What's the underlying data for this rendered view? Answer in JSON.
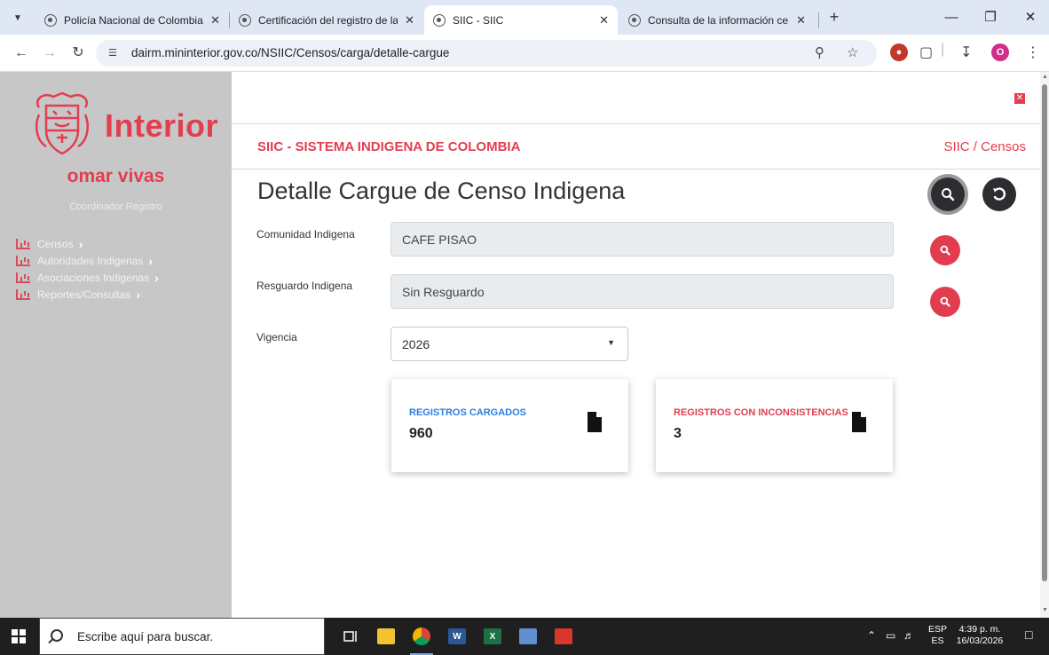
{
  "browser": {
    "tabs": [
      {
        "title": "Policía Nacional de Colombia",
        "active": false
      },
      {
        "title": "Certificación del registro de la a",
        "active": false
      },
      {
        "title": "SIIC - SIIC",
        "active": true
      },
      {
        "title": "Consulta de la información cens",
        "active": false
      }
    ],
    "url": "dairm.mininterior.gov.co/NSIIC/Censos/carga/detalle-cargue",
    "profile_initial": "O"
  },
  "sidebar": {
    "logo_text": "Interior",
    "user_name": "omar vivas",
    "user_role": "Coordinador Registro",
    "menu": [
      {
        "label": "Censos"
      },
      {
        "label": "Autoridades Indigenas"
      },
      {
        "label": "Asociaciones Indigenas"
      },
      {
        "label": "Reportes/Consultas"
      }
    ]
  },
  "header": {
    "app_title": "SIIC - SISTEMA INDIGENA DE COLOMBIA",
    "breadcrumb": "SIIC / Censos",
    "page_title": "Detalle Cargue de Censo Indigena"
  },
  "form": {
    "comunidad_label": "Comunidad Indigena",
    "comunidad_value": "CAFE PISAO",
    "resguardo_label": "Resguardo Indigena",
    "resguardo_value": "Sin Resguardo",
    "vigencia_label": "Vigencia",
    "vigencia_value": "2026"
  },
  "cards": [
    {
      "label": "REGISTROS CARGADOS",
      "value": "960",
      "color": "#2a7de1"
    },
    {
      "label": "REGISTROS CON INCONSISTENCIAS",
      "value": "3",
      "color": "#e23e50"
    }
  ],
  "colors": {
    "accent_red": "#e23e50",
    "sidebar_bg": "#c7c7c7",
    "dark_button": "#2b2d31",
    "tabstrip_bg": "#dfe6f4"
  },
  "taskbar": {
    "search_placeholder": "Escribe aquí para buscar.",
    "lang_1": "ESP",
    "lang_2": "ES",
    "time": "4:39 p. m.",
    "date": "16/03/2026"
  }
}
